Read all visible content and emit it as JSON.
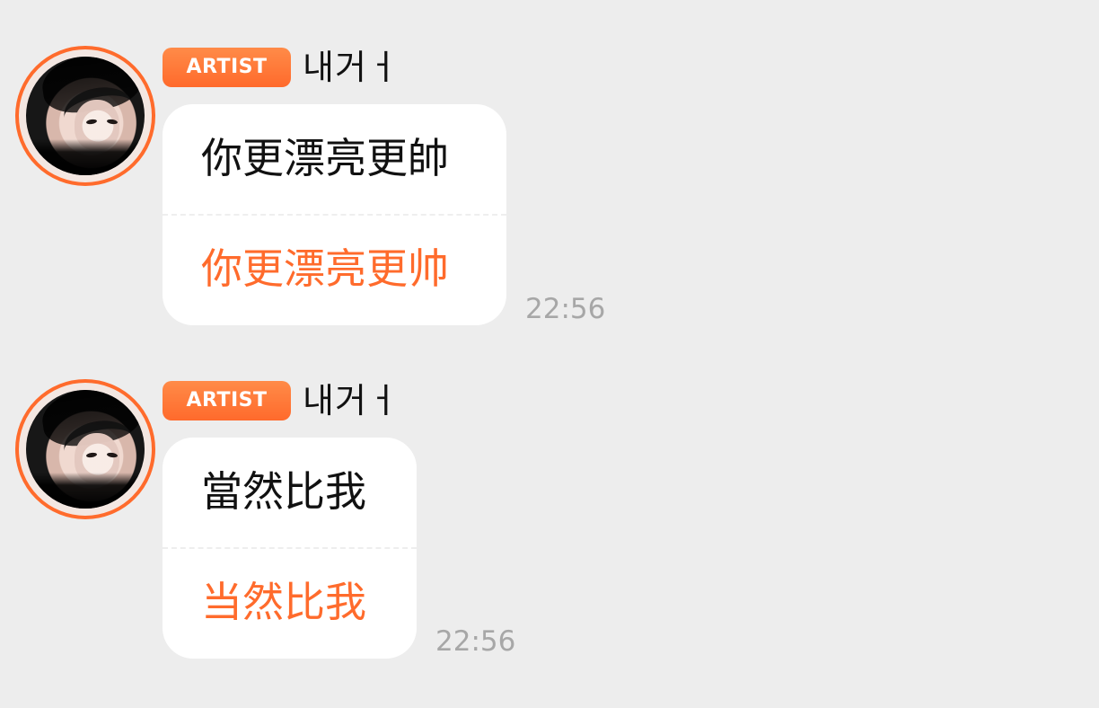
{
  "messages": [
    {
      "badge": "ARTIST",
      "name": "내거ㅓ",
      "original_text": "你更漂亮更帥",
      "translated_text": "你更漂亮更帅",
      "time": "22:56"
    },
    {
      "badge": "ARTIST",
      "name": "내거ㅓ",
      "original_text": "當然比我",
      "translated_text": "当然比我",
      "time": "22:56"
    }
  ],
  "colors": {
    "background": "#ededed",
    "accent": "#ff6b2c",
    "bubble": "#ffffff",
    "text": "#111111",
    "timestamp": "#a7a7a7"
  },
  "icons": {
    "avatar": "profile-photo"
  }
}
